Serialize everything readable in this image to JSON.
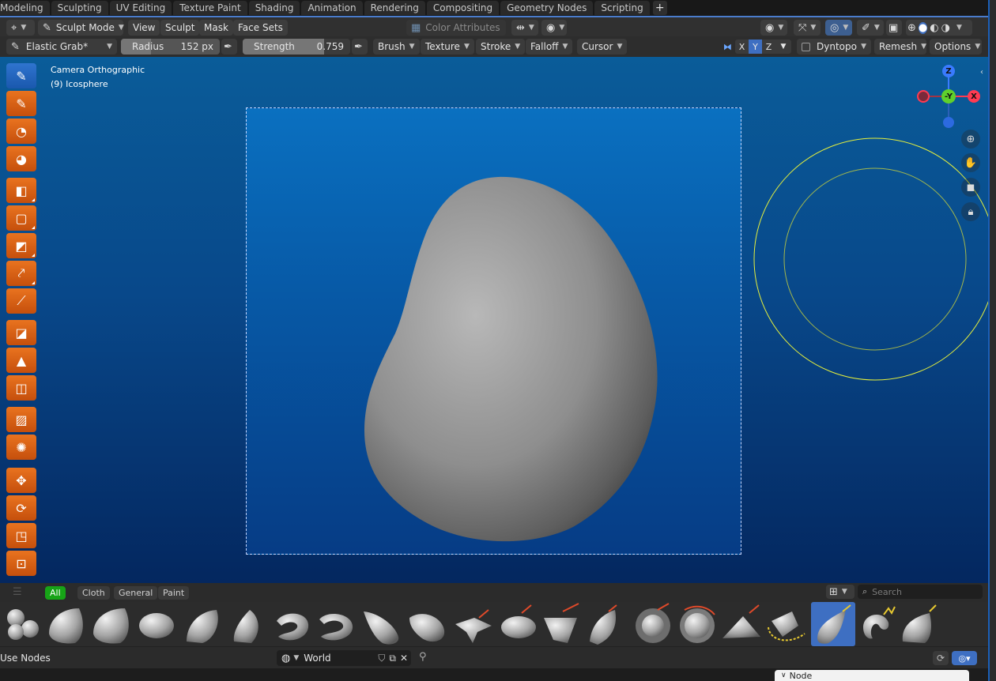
{
  "workspace_tabs": [
    "Modeling",
    "Sculpting",
    "UV Editing",
    "Texture Paint",
    "Shading",
    "Animation",
    "Rendering",
    "Compositing",
    "Geometry Nodes",
    "Scripting"
  ],
  "add_tab_label": "+",
  "header": {
    "mode": "Sculpt Mode",
    "menus": [
      "View",
      "Sculpt",
      "Mask",
      "Face Sets"
    ],
    "color_attributes": "Color Attributes"
  },
  "tool_settings": {
    "brush_name": "Elastic Grab*",
    "radius_label": "Radius",
    "radius_value": "152 px",
    "strength_label": "Strength",
    "strength_value": "0.759",
    "strength_fraction": 0.759,
    "menus": [
      "Brush",
      "Texture",
      "Stroke",
      "Falloff",
      "Cursor"
    ],
    "axes": [
      "X",
      "Y",
      "Z"
    ],
    "dyntopo": "Dyntopo",
    "remesh": "Remesh",
    "options": "Options"
  },
  "viewport": {
    "view_name": "Camera Orthographic",
    "object_name": "(9) Icosphere",
    "gizmo": {
      "z": "Z",
      "y": "-Y",
      "x": "X"
    }
  },
  "shelf": {
    "categories": [
      "All",
      "Cloth",
      "General",
      "Paint"
    ],
    "search_placeholder": "Search"
  },
  "nodebar": {
    "use_nodes": "Use Nodes",
    "world": "World"
  },
  "node_panel": {
    "tab": "Node"
  },
  "colors": {
    "accent": "#3e6fc2",
    "tool_orange": "#d9621a",
    "active_green": "#17a417",
    "brush_circle": "#e6f03c"
  }
}
